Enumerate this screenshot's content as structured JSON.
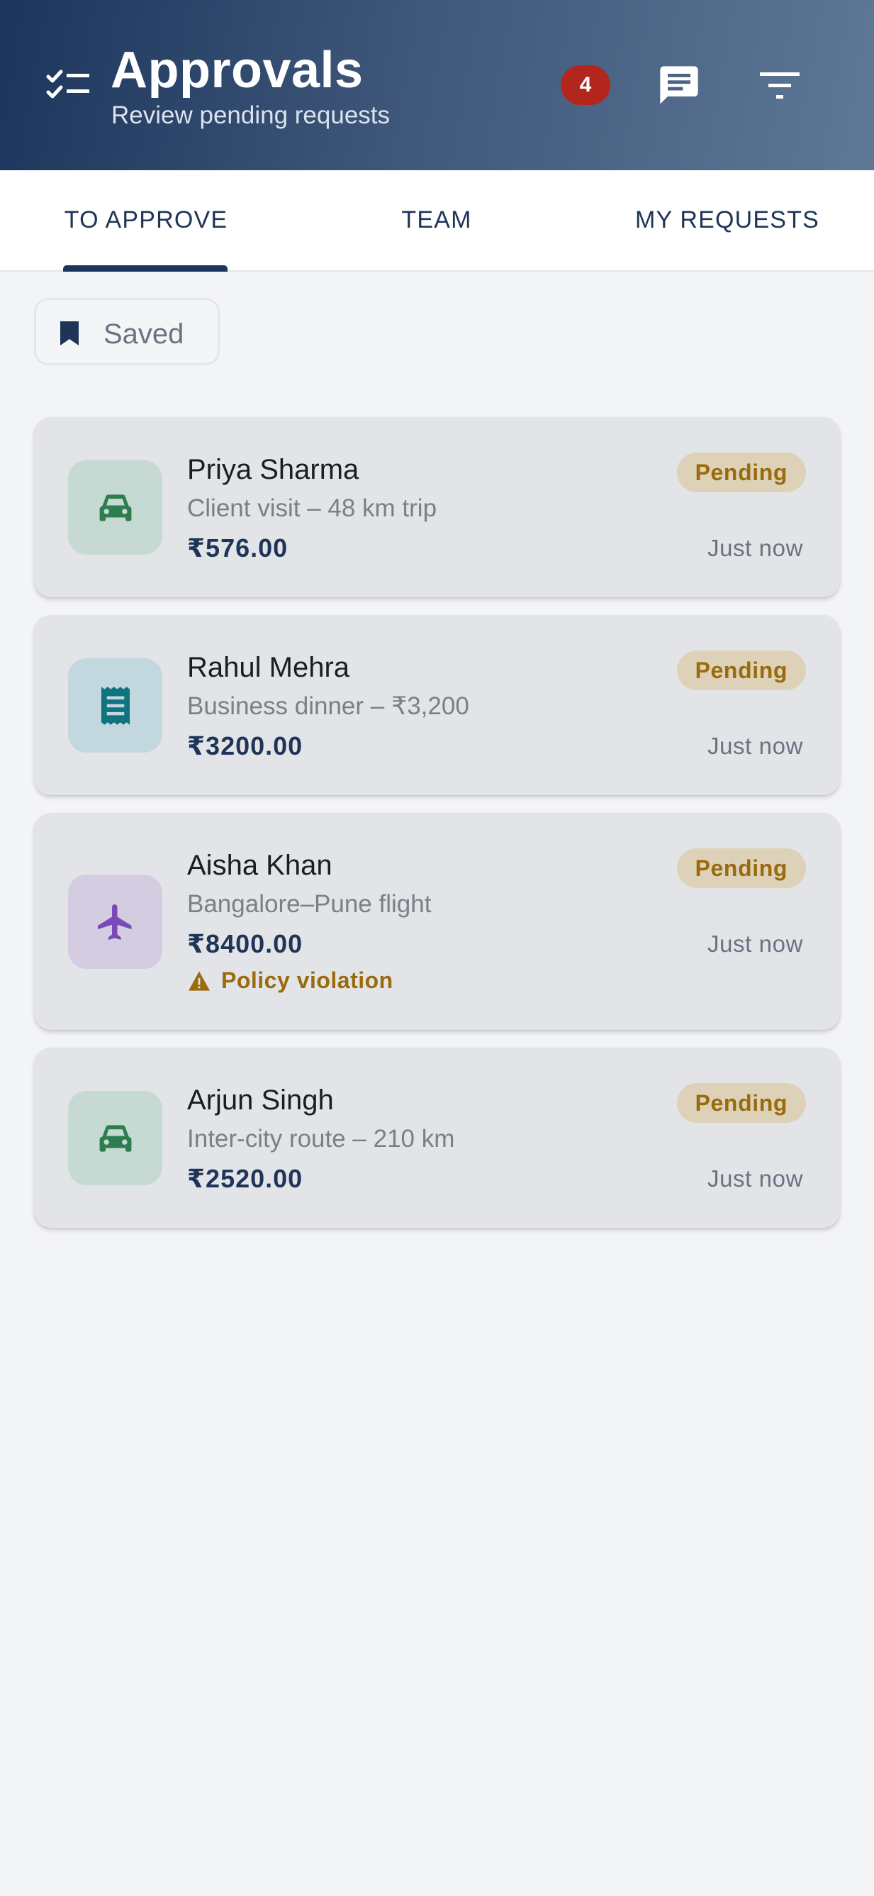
{
  "header": {
    "title": "Approvals",
    "subtitle": "Review pending requests",
    "notification_count": "4",
    "icons": [
      "checklist-icon",
      "chat-icon",
      "filter-icon"
    ]
  },
  "tabs": [
    {
      "label": "TO APPROVE",
      "active": true
    },
    {
      "label": "TEAM",
      "active": false
    },
    {
      "label": "MY REQUESTS",
      "active": false
    }
  ],
  "filter_chip": {
    "label": "Saved",
    "icon": "bookmark-icon"
  },
  "requests": [
    {
      "name": "Priya Sharma",
      "description": "Client visit – 48 km trip",
      "amount": "₹576.00",
      "status": "Pending",
      "time": "Just now",
      "icon": "car-icon",
      "icon_color": "#2e7d4f",
      "icon_bg": "#c6d9d3"
    },
    {
      "name": "Rahul Mehra",
      "description": "Business dinner – ₹3,200",
      "amount": "₹3200.00",
      "status": "Pending",
      "time": "Just now",
      "icon": "receipt-icon",
      "icon_color": "#0f7480",
      "icon_bg": "#c3d8de"
    },
    {
      "name": "Aisha Khan",
      "description": "Bangalore–Pune flight",
      "amount": "₹8400.00",
      "status": "Pending",
      "time": "Just now",
      "icon": "airplane-icon",
      "icon_color": "#7b49b8",
      "icon_bg": "#d4cde1",
      "policy_note": "Policy violation"
    },
    {
      "name": "Arjun Singh",
      "description": "Inter-city route – 210 km",
      "amount": "₹2520.00",
      "status": "Pending",
      "time": "Just now",
      "icon": "car-icon",
      "icon_color": "#2e7d4f",
      "icon_bg": "#c6d9d3"
    }
  ],
  "colors": {
    "brand": "#1c355c",
    "pending_text": "#9a6b0d",
    "pending_bg": "#ddd2b8",
    "badge": "#b3261e"
  }
}
